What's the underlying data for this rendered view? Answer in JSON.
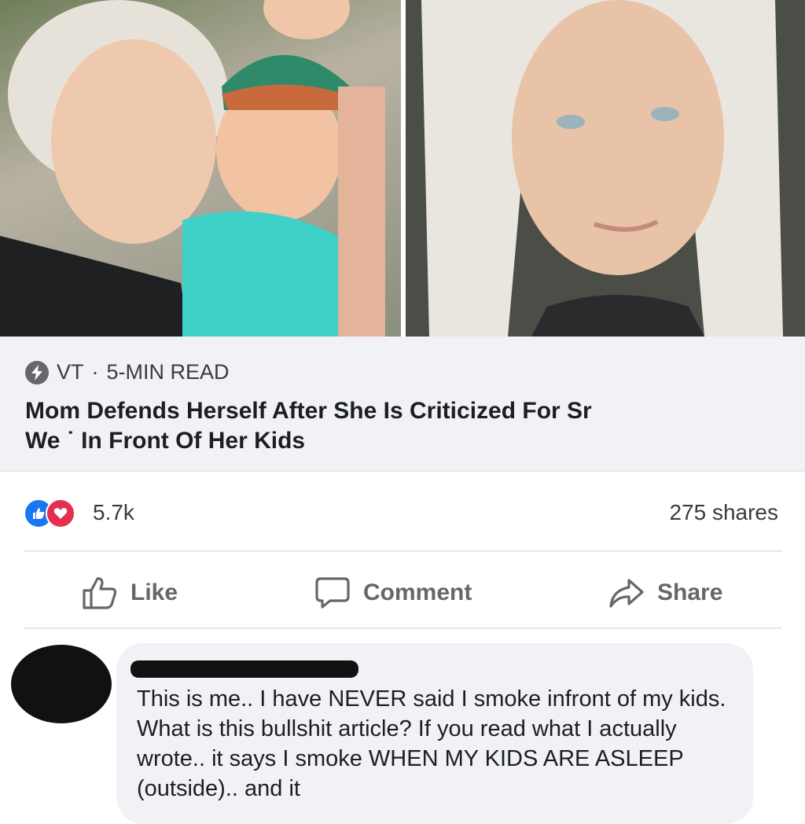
{
  "preview": {
    "source": "VT",
    "dot": "·",
    "read_time": "5-MIN READ",
    "headline_line1": "Mom Defends Herself After She Is Criticized For Sr",
    "headline_line2": "We   ˙ In Front Of Her Kids"
  },
  "stats": {
    "reaction_count": "5.7k",
    "shares": "275 shares"
  },
  "actions": {
    "like": "Like",
    "comment": "Comment",
    "share": "Share"
  },
  "comment": {
    "text": "This is me.. I have NEVER said I smoke infront of my kids. What is this bullshit article? If you read what I actually wrote.. it says I smoke WHEN MY KIDS ARE ASLEEP (outside).. and it"
  },
  "colors": {
    "like_blue": "#1877f2",
    "love_red": "#e4304f",
    "action_gray": "#65676b",
    "card_bg": "#f0f2f5"
  }
}
